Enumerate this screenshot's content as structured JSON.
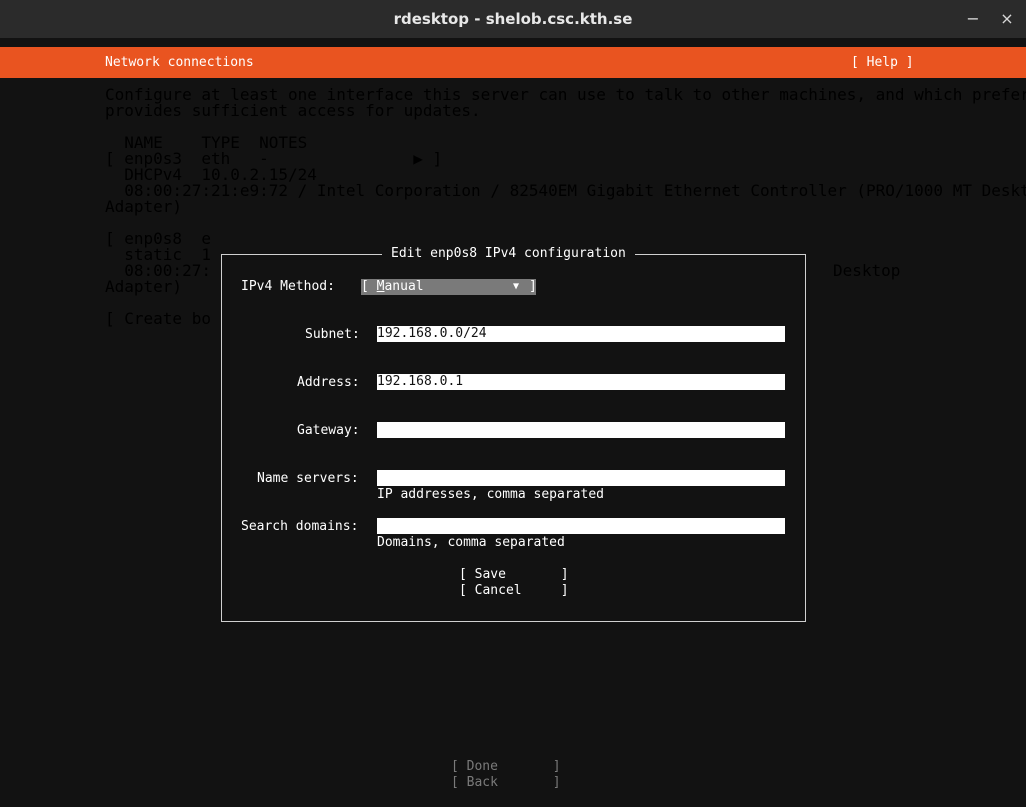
{
  "window": {
    "title": "rdesktop - shelob.csc.kth.se",
    "controls": {
      "minimize": "−",
      "maximize": "□",
      "close": "×"
    }
  },
  "header": {
    "title": "Network connections",
    "help": "[ Help ]"
  },
  "intro": [
    "Configure at least one interface this server can use to talk to other machines, and which preferably",
    "provides sufficient access for updates."
  ],
  "table_header": "  NAME    TYPE  NOTES",
  "interfaces": [
    {
      "row": "[ enp0s3  eth   -               ▶ ]",
      "addr": "  DHCPv4  10.0.2.15/24",
      "detail": "  08:00:27:21:e9:72 / Intel Corporation / 82540EM Gigabit Ethernet Controller (PRO/1000 MT Desktop",
      "detail2": "Adapter)"
    },
    {
      "row": "[ enp0s8  e",
      "addr": "  static  1",
      "detail": "  08:00:27:",
      "detail_right": "Desktop",
      "detail2": "Adapter)"
    }
  ],
  "create_bond": "[ Create bo",
  "dialog": {
    "title": "Edit enp0s8 IPv4 configuration",
    "method_label": "IPv4 Method:",
    "method_open": "[ ",
    "method_accel": "M",
    "method_rest": "anual",
    "method_arrow": "▼",
    "method_close": "]",
    "subnet_label": "Subnet:",
    "subnet_value": "192.168.0.0/24",
    "address_label": "Address:",
    "address_value": "192.168.0.1",
    "gateway_label": "Gateway:",
    "gateway_value": "",
    "nameservers_label": "Name servers:",
    "nameservers_value": "",
    "nameservers_hint": "IP addresses, comma separated",
    "searchdomains_label": "Search domains:",
    "searchdomains_value": "",
    "searchdomains_hint": "Domains, comma separated",
    "save": "[ Save       ]",
    "cancel": "[ Cancel     ]"
  },
  "footer": {
    "done": "[ Done       ]",
    "back": "[ Back       ]"
  },
  "colors": {
    "accent": "#e95420",
    "terminal_bg": "#121212",
    "muted_text": "#9a9a9a"
  }
}
